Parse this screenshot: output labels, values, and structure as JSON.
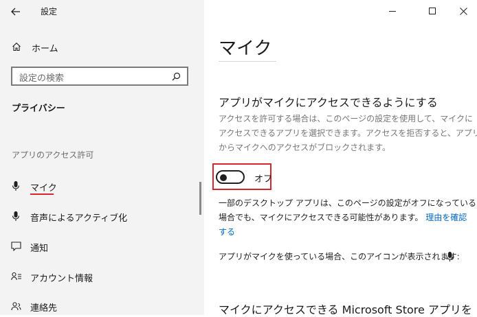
{
  "window": {
    "title": "設定"
  },
  "sidebar": {
    "home_label": "ホーム",
    "search_placeholder": "設定の検索",
    "section_title": "プライバシー",
    "group_label": "アプリのアクセス許可",
    "items": [
      {
        "label": "マイク",
        "icon": "microphone-icon",
        "selected": true
      },
      {
        "label": "音声によるアクティブ化",
        "icon": "microphone-icon"
      },
      {
        "label": "通知",
        "icon": "notification-icon"
      },
      {
        "label": "アカウント情報",
        "icon": "account-info-icon"
      },
      {
        "label": "連絡先",
        "icon": "contacts-icon"
      }
    ]
  },
  "main": {
    "title": "マイク",
    "section_heading": "アプリがマイクにアクセスできるようにする",
    "description_lines": [
      "アクセスを許可する場合は、このページの設定を使用して、マイクに",
      "アクセスできるアプリを選択できます。アクセスを拒否すると、アプリ",
      "からマイクへのアクセスがブロックされます。"
    ],
    "toggle": {
      "state": "off",
      "label": "オフ"
    },
    "desktop_note_lines": [
      "一部のデスクトップ アプリは、このページの設定がオフになっている",
      "場合でも、マイクにアクセスできる可能性があります。"
    ],
    "desktop_note_link_part1": "理由を確認",
    "desktop_note_link_part2": "する",
    "icon_note": "アプリがマイクを使っている場合、このアイコンが表示されます:",
    "bottom_heading": "マイクにアクセスできる Microsoft Store アプリを"
  },
  "colors": {
    "accent_red": "#d9242b",
    "link": "#0067c0",
    "sidebar_bg": "#f3f3f3"
  }
}
